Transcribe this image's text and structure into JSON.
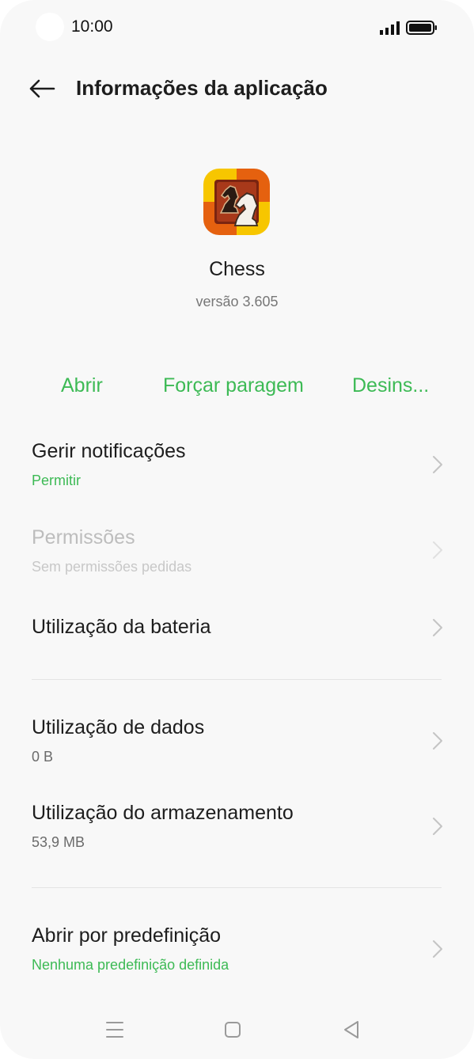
{
  "status_bar": {
    "time": "10:00",
    "icons": [
      "signal-icon",
      "battery-icon"
    ]
  },
  "header": {
    "back_icon": "arrow-left-icon",
    "title": "Informações da aplicação"
  },
  "app": {
    "icon": "chess-app-icon",
    "name": "Chess",
    "version": "versão 3.605"
  },
  "actions": {
    "open": "Abrir",
    "force_stop": "Forçar paragem",
    "uninstall": "Desins..."
  },
  "settings": [
    {
      "title": "Gerir notificações",
      "subtitle": "Permitir",
      "subtitle_color": "#3dba55"
    },
    {
      "title": "Permissões",
      "subtitle": "Sem permissões pedidas",
      "disabled": true
    },
    {
      "title": "Utilização da bateria"
    },
    {
      "title": "Utilização de dados",
      "subtitle": "0 B"
    },
    {
      "title": "Utilização do armazenamento",
      "subtitle": "53,9 MB"
    },
    {
      "title": "Abrir por predefinição",
      "subtitle": "Nenhuma predefinição definida",
      "subtitle_color": "#3dba55"
    }
  ],
  "nav_bar": {
    "icons": [
      "menu-icon",
      "home-icon",
      "back-triangle-icon"
    ]
  },
  "colors": {
    "accent": "#3dba55",
    "background": "#f8f8f8",
    "disabled_text": "#bdbdbd"
  }
}
